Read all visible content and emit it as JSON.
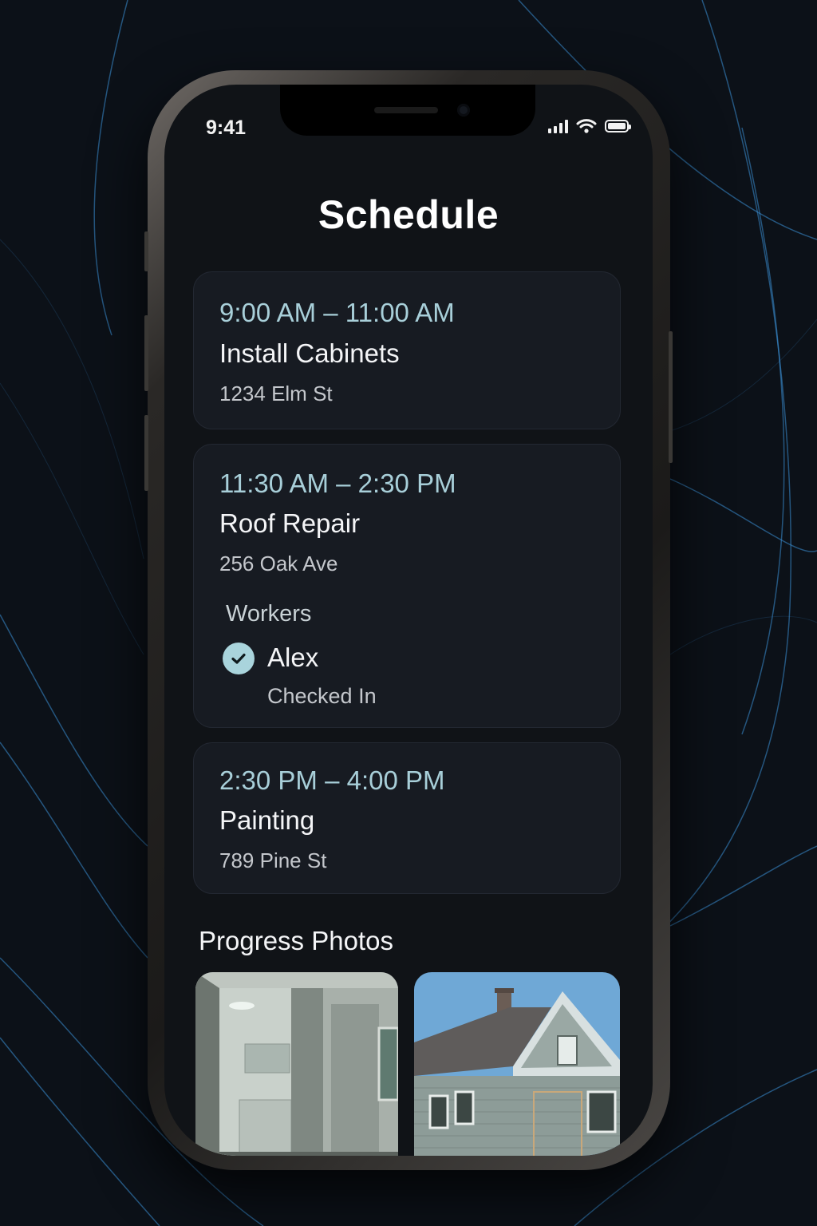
{
  "status_bar": {
    "time": "9:41"
  },
  "page": {
    "title": "Schedule"
  },
  "schedule": [
    {
      "time": "9:00 AM – 11:00 AM",
      "title": "Install Cabinets",
      "address": "1234 Elm St"
    },
    {
      "time": "11:30 AM – 2:30 PM",
      "title": "Roof Repair",
      "address": "256 Oak Ave",
      "workers_label": "Workers",
      "workers": [
        {
          "name": "Alex",
          "status": "Checked In",
          "icon": "check-circle-icon"
        }
      ]
    },
    {
      "time": "2:30 PM – 4:00 PM",
      "title": "Painting",
      "address": "789 Pine St"
    }
  ],
  "progress_photos": {
    "title": "Progress Photos",
    "photos": [
      {
        "subject": "interior-kitchen-photo"
      },
      {
        "subject": "house-exterior-photo"
      }
    ]
  },
  "colors": {
    "accent": "#a8cfd9",
    "card_background": "#171b22",
    "screen_background": "#101317",
    "swirl": "#3b8fd6"
  }
}
